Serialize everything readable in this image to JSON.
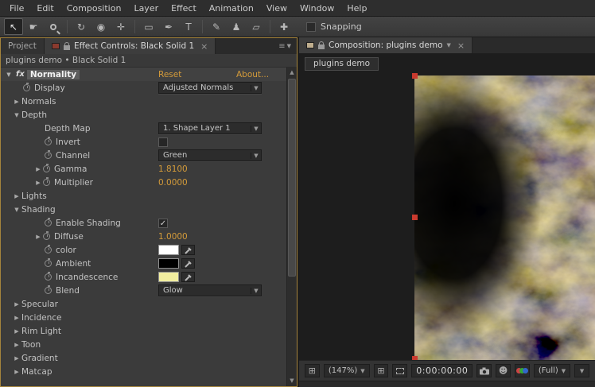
{
  "colors": {
    "accent_orange": "#d49b3a",
    "panel_focus_border": "#a5843c",
    "handle_red": "#c93a2e"
  },
  "menubar": {
    "items": [
      "File",
      "Edit",
      "Composition",
      "Layer",
      "Effect",
      "Animation",
      "View",
      "Window",
      "Help"
    ]
  },
  "toolbar": {
    "tools": [
      {
        "name": "selection-tool",
        "selected": true
      },
      {
        "name": "hand-tool",
        "selected": false
      },
      {
        "name": "zoom-tool",
        "selected": false
      },
      {
        "name": "rotation-tool",
        "selected": false
      },
      {
        "name": "unified-camera-tool",
        "selected": false
      },
      {
        "name": "pan-behind-tool",
        "selected": false
      },
      {
        "name": "shape-tool",
        "selected": false
      },
      {
        "name": "pen-tool",
        "selected": false
      },
      {
        "name": "type-tool",
        "selected": false
      },
      {
        "name": "brush-tool",
        "selected": false
      },
      {
        "name": "clone-stamp-tool",
        "selected": false
      },
      {
        "name": "eraser-tool",
        "selected": false
      },
      {
        "name": "puppet-pin-tool",
        "selected": false
      }
    ],
    "snapping_label": "Snapping",
    "snapping_checked": false
  },
  "left_panel": {
    "tabs": {
      "project": "Project",
      "effect_controls": "Effect Controls: Black Solid 1"
    },
    "breadcrumb": "plugins demo • Black Solid 1",
    "effect": {
      "name": "Normality",
      "reset_label": "Reset",
      "about_label": "About...",
      "rows": [
        {
          "pad": 28,
          "arrow": "",
          "sw": true,
          "label": "Display",
          "ctl": {
            "type": "dropdown",
            "value": "Adjusted Normals"
          }
        },
        {
          "pad": 14,
          "arrow": "r",
          "sw": false,
          "label": "Normals"
        },
        {
          "pad": 14,
          "arrow": "d",
          "sw": false,
          "label": "Depth"
        },
        {
          "pad": 55,
          "arrow": "",
          "sw": false,
          "label": "Depth Map",
          "ctl": {
            "type": "dropdown",
            "value": "1. Shape Layer 1"
          }
        },
        {
          "pad": 55,
          "arrow": "",
          "sw": true,
          "label": "Invert",
          "ctl": {
            "type": "checkbox",
            "checked": false
          }
        },
        {
          "pad": 55,
          "arrow": "",
          "sw": true,
          "label": "Channel",
          "ctl": {
            "type": "dropdown",
            "value": "Green"
          }
        },
        {
          "pad": 41,
          "arrow": "r",
          "sw": true,
          "label": "Gamma",
          "ctl": {
            "type": "value",
            "value": "1.8100"
          }
        },
        {
          "pad": 41,
          "arrow": "r",
          "sw": true,
          "label": "Multiplier",
          "ctl": {
            "type": "value",
            "value": "0.0000"
          }
        },
        {
          "pad": 14,
          "arrow": "r",
          "sw": false,
          "label": "Lights"
        },
        {
          "pad": 14,
          "arrow": "d",
          "sw": false,
          "label": "Shading"
        },
        {
          "pad": 55,
          "arrow": "",
          "sw": true,
          "label": "Enable Shading",
          "ctl": {
            "type": "checkbox",
            "checked": true
          }
        },
        {
          "pad": 41,
          "arrow": "r",
          "sw": true,
          "label": "Diffuse",
          "ctl": {
            "type": "value",
            "value": "1.0000"
          }
        },
        {
          "pad": 55,
          "arrow": "",
          "sw": true,
          "label": "color",
          "ctl": {
            "type": "color",
            "color": "#ffffff"
          }
        },
        {
          "pad": 55,
          "arrow": "",
          "sw": true,
          "label": "Ambient",
          "ctl": {
            "type": "color",
            "color": "#000000"
          }
        },
        {
          "pad": 55,
          "arrow": "",
          "sw": true,
          "label": "Incandescence",
          "ctl": {
            "type": "color",
            "color": "#f2ee9f"
          }
        },
        {
          "pad": 55,
          "arrow": "",
          "sw": true,
          "label": "Blend",
          "ctl": {
            "type": "dropdown",
            "value": "Glow"
          }
        },
        {
          "pad": 14,
          "arrow": "r",
          "sw": false,
          "label": "Specular"
        },
        {
          "pad": 14,
          "arrow": "r",
          "sw": false,
          "label": "Incidence"
        },
        {
          "pad": 14,
          "arrow": "r",
          "sw": false,
          "label": "Rim Light"
        },
        {
          "pad": 14,
          "arrow": "r",
          "sw": false,
          "label": "Toon"
        },
        {
          "pad": 14,
          "arrow": "r",
          "sw": false,
          "label": "Gradient"
        },
        {
          "pad": 14,
          "arrow": "r",
          "sw": false,
          "label": "Matcap"
        }
      ]
    }
  },
  "right_panel": {
    "tab_label": "Composition: plugins demo",
    "comp_button_label": "plugins demo",
    "statusbar": {
      "zoom": "(147%)",
      "timecode": "0:00:00:00",
      "resolution": "(Full)"
    }
  }
}
